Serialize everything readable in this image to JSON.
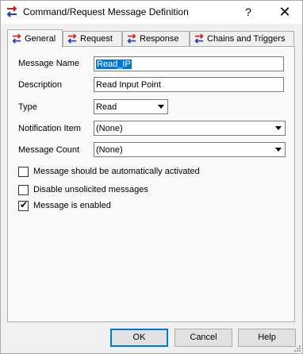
{
  "window": {
    "title": "Command/Request Message Definition",
    "help_glyph": "?",
    "close_glyph": "✕"
  },
  "tabs": [
    {
      "label": "General",
      "icon": "message-arrows-icon",
      "active": true
    },
    {
      "label": "Request",
      "icon": "message-arrows-icon",
      "active": false
    },
    {
      "label": "Response",
      "icon": "message-arrows-icon",
      "active": false
    },
    {
      "label": "Chains and Triggers",
      "icon": "message-arrows-icon",
      "active": false
    }
  ],
  "form": {
    "message_name_label": "Message Name",
    "message_name_value": "Read_IP",
    "description_label": "Description",
    "description_value": "Read Input Point",
    "type_label": "Type",
    "type_value": "Read",
    "notification_item_label": "Notification Item",
    "notification_item_value": "(None)",
    "message_count_label": "Message Count",
    "message_count_value": "(None)"
  },
  "checkboxes": [
    {
      "label": "Message should be automatically activated",
      "checked": false
    },
    {
      "label": "Disable unsolicited messages",
      "checked": false
    },
    {
      "label": "Message is enabled",
      "checked": true
    }
  ],
  "buttons": {
    "ok": "OK",
    "cancel": "Cancel",
    "help": "Help"
  },
  "colors": {
    "icon_red": "#d42020",
    "icon_blue": "#1f3fbf",
    "selection": "#0078d7"
  }
}
